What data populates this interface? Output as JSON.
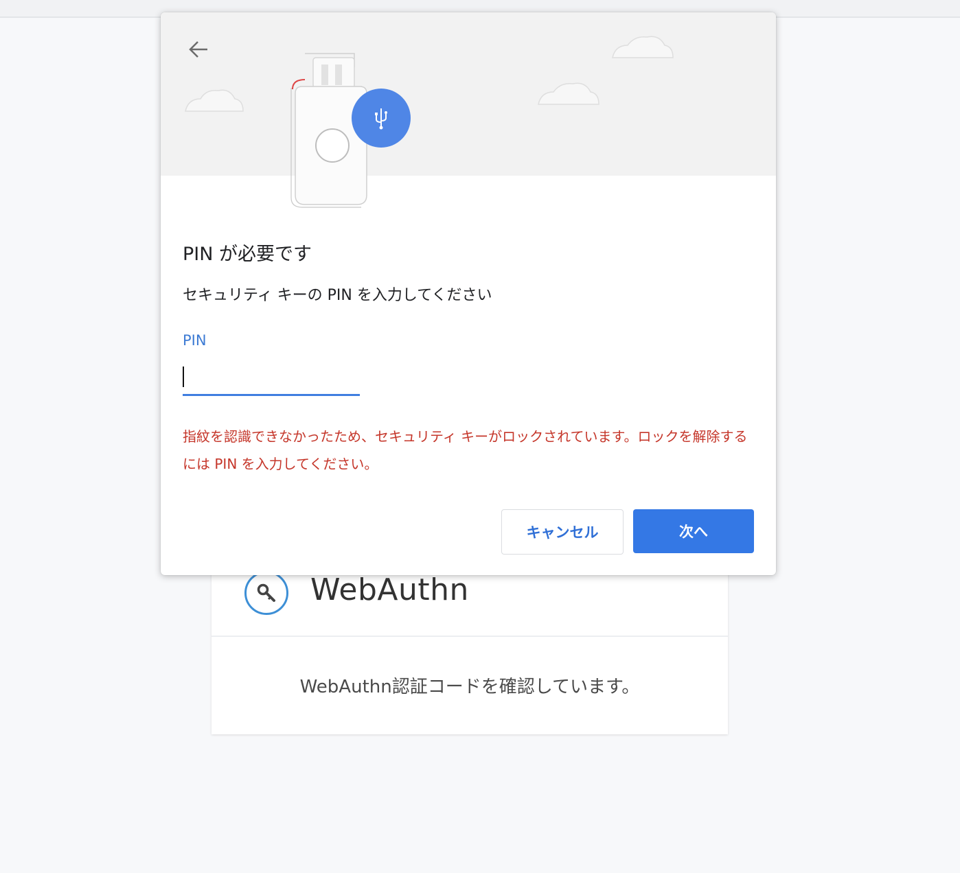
{
  "dialog": {
    "title": "PIN が必要です",
    "description": "セキュリティ キーの PIN を入力してください",
    "pin_label": "PIN",
    "pin_value": "",
    "error": "指紋を認識できなかったため、セキュリティ キーがロックされています。ロックを解除するには PIN を入力してください。",
    "cancel_label": "キャンセル",
    "next_label": "次へ"
  },
  "background_page": {
    "title": "WebAuthn",
    "status": "WebAuthn認証コードを確認しています。"
  },
  "colors": {
    "accent": "#3478e5",
    "error": "#c5362a",
    "illustration_bg": "#f2f2f2"
  },
  "icons": [
    "back-arrow-icon",
    "usb-security-key-illustration",
    "usb-icon",
    "cloud-icon",
    "key-icon"
  ]
}
